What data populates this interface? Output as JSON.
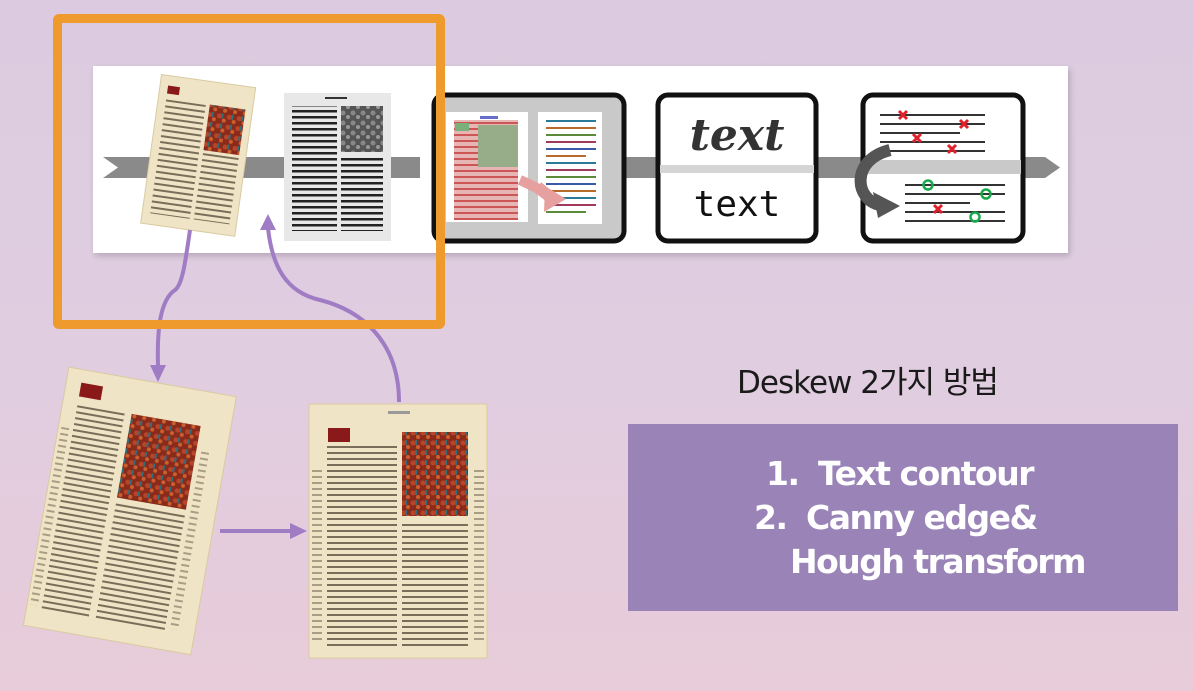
{
  "pipeline": {
    "ocr_glyph_stylized": "text",
    "ocr_glyph_plain": "text"
  },
  "deskew": {
    "title": "Deskew 2가지 방법",
    "methods": [
      {
        "number": "1.",
        "label": "Text contour"
      },
      {
        "number": "2.",
        "label": "Canny edge&"
      },
      {
        "number": "",
        "label": "Hough transform"
      }
    ]
  },
  "colors": {
    "highlight": "#ee9a2c",
    "method_box": "#9a84b7",
    "arrow": "#a07cc4",
    "pipeline_bar": "#8a8a8a"
  }
}
